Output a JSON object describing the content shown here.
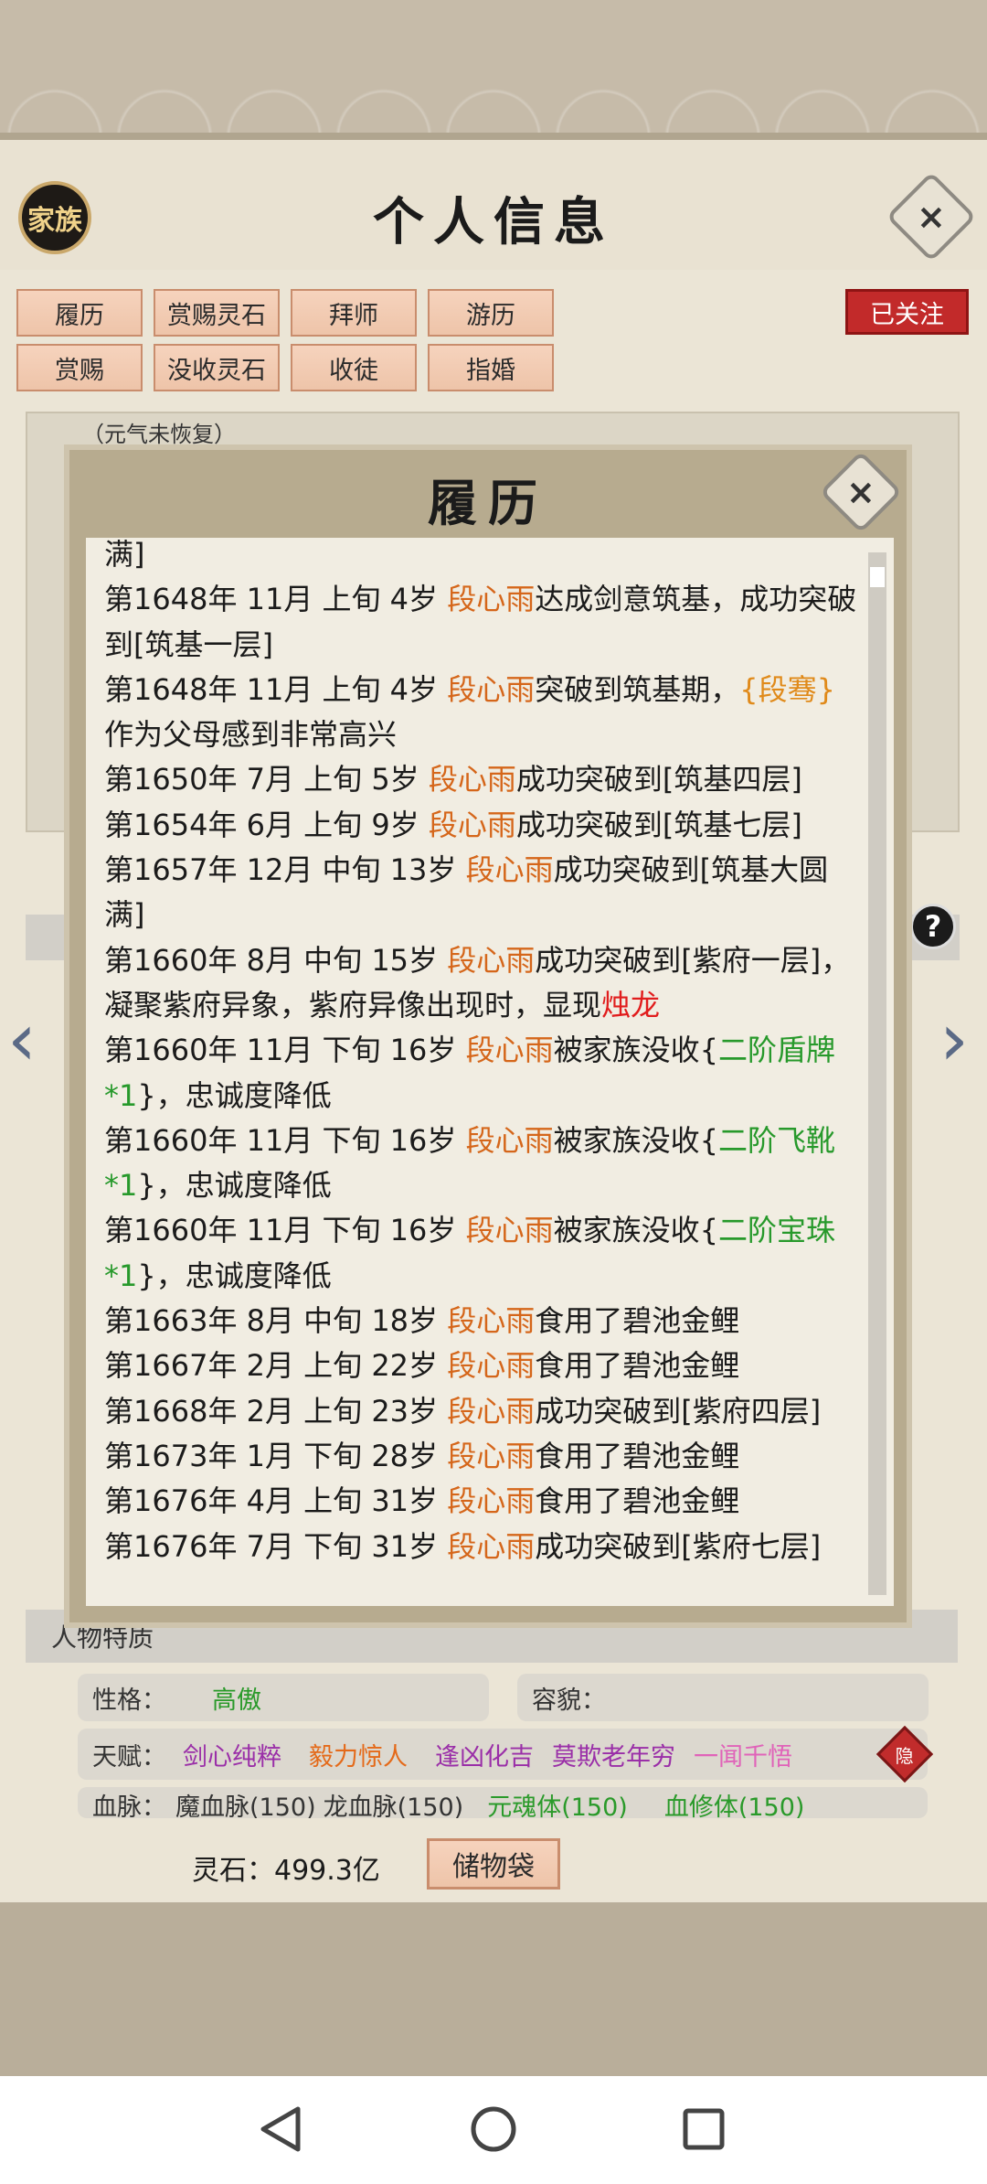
{
  "header": {
    "title": "个人信息",
    "family_badge": "家族",
    "close_icon": "×",
    "followed_label": "已关注"
  },
  "tabs": [
    "履历",
    "赏赐灵石",
    "拜师",
    "游历",
    "赏赐",
    "没收灵石",
    "收徒",
    "指婚"
  ],
  "background": {
    "vitality_note": "（元气未恢复）",
    "traits_section_label": "人物特质",
    "personality_label": "性格：",
    "personality_value": "高傲",
    "appearance_label": "容貌：",
    "talent_label": "天赋：",
    "talents": [
      "剑心纯粹",
      "毅力惊人",
      "逢凶化吉",
      "莫欺老年穷",
      "一闻千悟"
    ],
    "hide_label": "隐",
    "bloodline_label": "血脉：",
    "bloodlines": [
      "魔血脉(150)",
      "龙血脉(150)",
      "元魂体(150)",
      "血修体(150)"
    ],
    "help_icon": "?"
  },
  "footer": {
    "spirit_stone": "灵石：499.3亿",
    "storage_button": "储物袋"
  },
  "modal": {
    "title": "履历",
    "close_icon": "×",
    "log": [
      [
        {
          "t": "满]"
        }
      ],
      [
        {
          "t": "第1648年 11月 上旬  4岁  "
        },
        {
          "t": "段心雨",
          "c": "nm"
        },
        {
          "t": "达成剑意筑基，成功突破到[筑基一层]"
        }
      ],
      [
        {
          "t": "第1648年 11月 上旬  4岁  "
        },
        {
          "t": "段心雨",
          "c": "nm"
        },
        {
          "t": "突破到筑基期，"
        },
        {
          "t": "{段骞}",
          "c": "gd"
        },
        {
          "t": "作为父母感到非常高兴"
        }
      ],
      [
        {
          "t": "第1650年 7月 上旬  5岁  "
        },
        {
          "t": "段心雨",
          "c": "nm"
        },
        {
          "t": "成功突破到[筑基四层]"
        }
      ],
      [
        {
          "t": "第1654年 6月 上旬  9岁  "
        },
        {
          "t": "段心雨",
          "c": "nm"
        },
        {
          "t": "成功突破到[筑基七层]"
        }
      ],
      [
        {
          "t": "第1657年 12月 中旬  13岁  "
        },
        {
          "t": "段心雨",
          "c": "nm"
        },
        {
          "t": "成功突破到[筑基大圆满]"
        }
      ],
      [
        {
          "t": "第1660年 8月 中旬  15岁  "
        },
        {
          "t": "段心雨",
          "c": "nm"
        },
        {
          "t": "成功突破到[紫府一层]，凝聚紫府异象，紫府异像出现时，显现"
        },
        {
          "t": "烛龙",
          "c": "rd"
        }
      ],
      [
        {
          "t": "第1660年 11月 下旬  16岁  "
        },
        {
          "t": "段心雨",
          "c": "nm"
        },
        {
          "t": "被家族没收{"
        },
        {
          "t": "二阶盾牌*1",
          "c": "it"
        },
        {
          "t": "}，忠诚度降低"
        }
      ],
      [
        {
          "t": "第1660年 11月 下旬  16岁  "
        },
        {
          "t": "段心雨",
          "c": "nm"
        },
        {
          "t": "被家族没收{"
        },
        {
          "t": "二阶飞靴*1",
          "c": "it"
        },
        {
          "t": "}，忠诚度降低"
        }
      ],
      [
        {
          "t": "第1660年 11月 下旬  16岁  "
        },
        {
          "t": "段心雨",
          "c": "nm"
        },
        {
          "t": "被家族没收{"
        },
        {
          "t": "二阶宝珠*1",
          "c": "it"
        },
        {
          "t": "}，忠诚度降低"
        }
      ],
      [
        {
          "t": "第1663年 8月 中旬  18岁  "
        },
        {
          "t": "段心雨",
          "c": "nm"
        },
        {
          "t": "食用了碧池金鲤"
        }
      ],
      [
        {
          "t": "第1667年 2月 上旬  22岁  "
        },
        {
          "t": "段心雨",
          "c": "nm"
        },
        {
          "t": "食用了碧池金鲤"
        }
      ],
      [
        {
          "t": "第1668年 2月 上旬 23岁  "
        },
        {
          "t": "段心雨",
          "c": "nm"
        },
        {
          "t": "成功突破到[紫府四层]"
        }
      ],
      [
        {
          "t": "第1673年 1月 下旬  28岁  "
        },
        {
          "t": "段心雨",
          "c": "nm"
        },
        {
          "t": "食用了碧池金鲤"
        }
      ],
      [
        {
          "t": "第1676年 4月 上旬  31岁  "
        },
        {
          "t": "段心雨",
          "c": "nm"
        },
        {
          "t": "食用了碧池金鲤"
        }
      ],
      [
        {
          "t": "第1676年 7月 下旬  31岁  "
        },
        {
          "t": "段心雨",
          "c": "nm"
        },
        {
          "t": "成功突破到[紫府七层]"
        }
      ]
    ]
  },
  "nav": {
    "back_icon": "triangle-back-icon",
    "home_icon": "circle-home-icon",
    "recents_icon": "square-recents-icon"
  }
}
